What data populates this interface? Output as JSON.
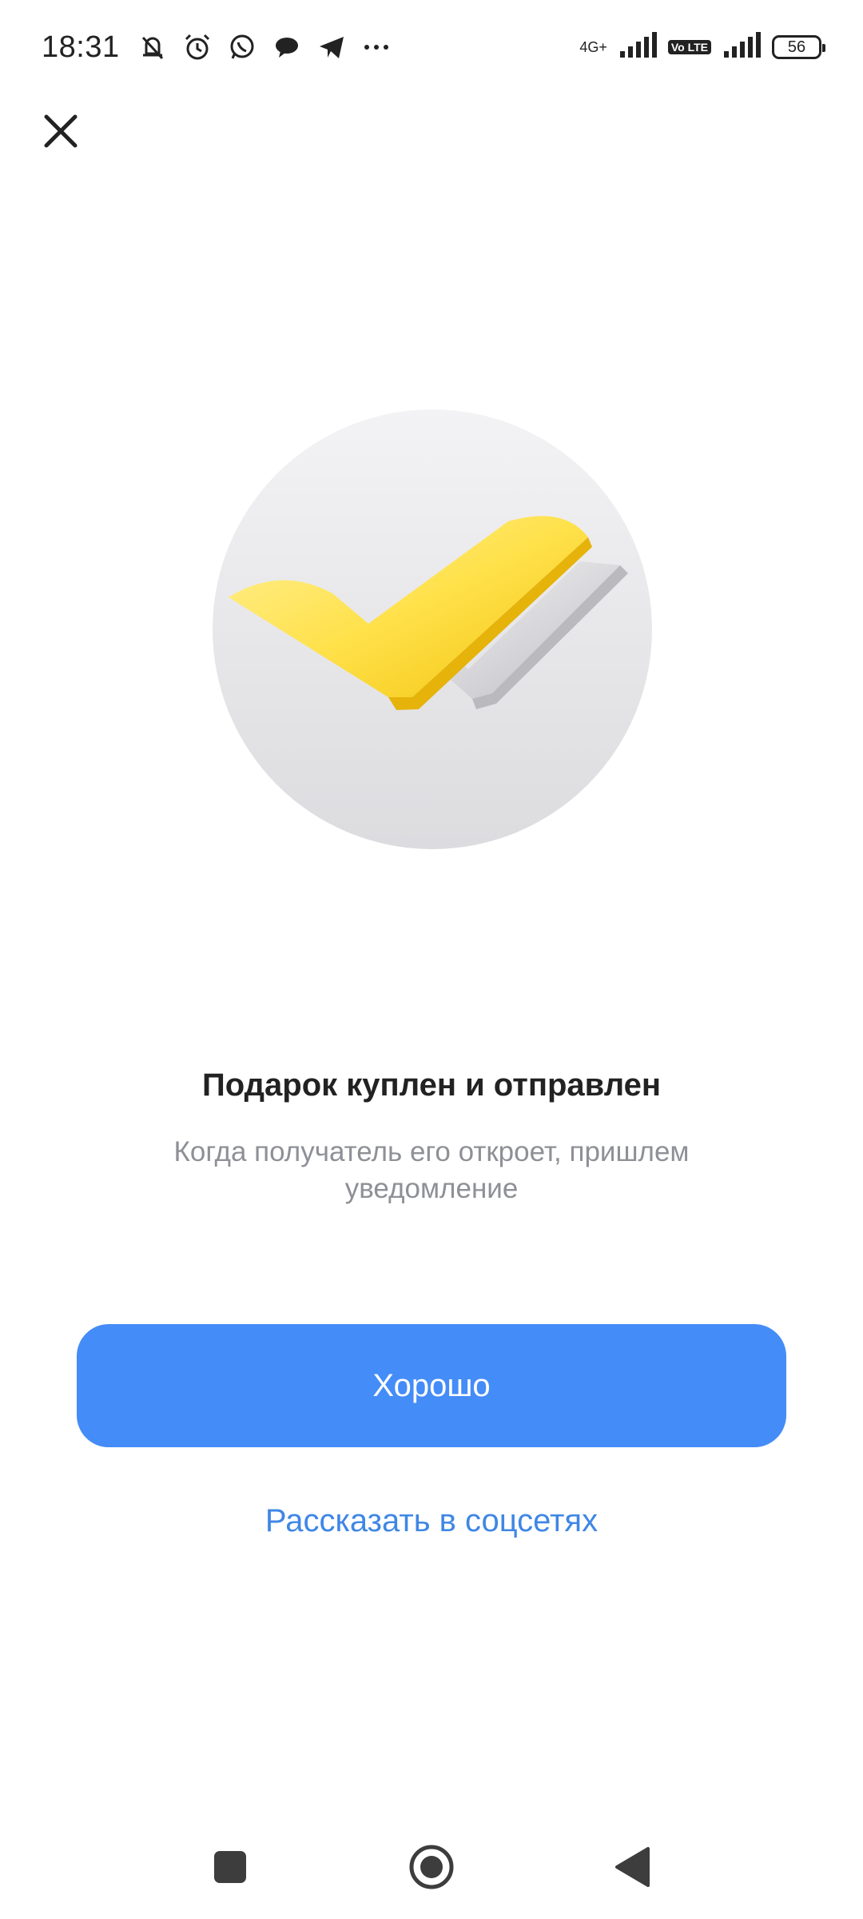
{
  "status_bar": {
    "time": "18:31",
    "network_label": "4G+",
    "volte_label": "Vo\nLTE",
    "battery_level": "56",
    "icons": [
      "mute-icon",
      "alarm-icon",
      "whatsapp-icon",
      "chat-icon",
      "telegram-icon",
      "more-icon"
    ]
  },
  "header": {
    "close_icon": "close-icon"
  },
  "hero": {
    "illustration": "double-check-icon",
    "colors": {
      "primary": "#FFD52E",
      "secondary": "#D8D8DB"
    }
  },
  "content": {
    "title": "Подарок куплен и отправлен",
    "subtitle": "Когда получатель его откроет, пришлем уведомление"
  },
  "actions": {
    "primary_label": "Хорошо",
    "share_label": "Рассказать в соцсетях",
    "accent": "#448CF7"
  },
  "nav": {
    "icons": [
      "recents-icon",
      "home-icon",
      "back-icon"
    ]
  }
}
